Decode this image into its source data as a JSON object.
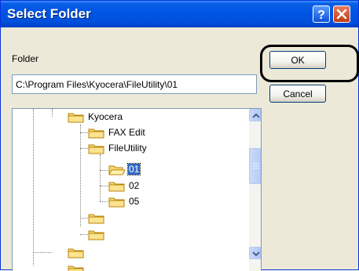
{
  "window": {
    "title": "Select Folder"
  },
  "folder_label": "Folder",
  "path_value": "C:\\Program Files\\Kyocera\\FileUtility\\01",
  "buttons": {
    "ok": "OK",
    "cancel": "Cancel"
  },
  "tree": {
    "kyocera": "Kyocera",
    "fax_edit": "FAX Edit",
    "file_utility": "FileUtility",
    "folder_01": "01",
    "folder_02": "02",
    "folder_05": "05"
  },
  "colors": {
    "titlebar": "#0054e3",
    "selection": "#316ac5",
    "dialog_bg": "#ece9d8"
  }
}
